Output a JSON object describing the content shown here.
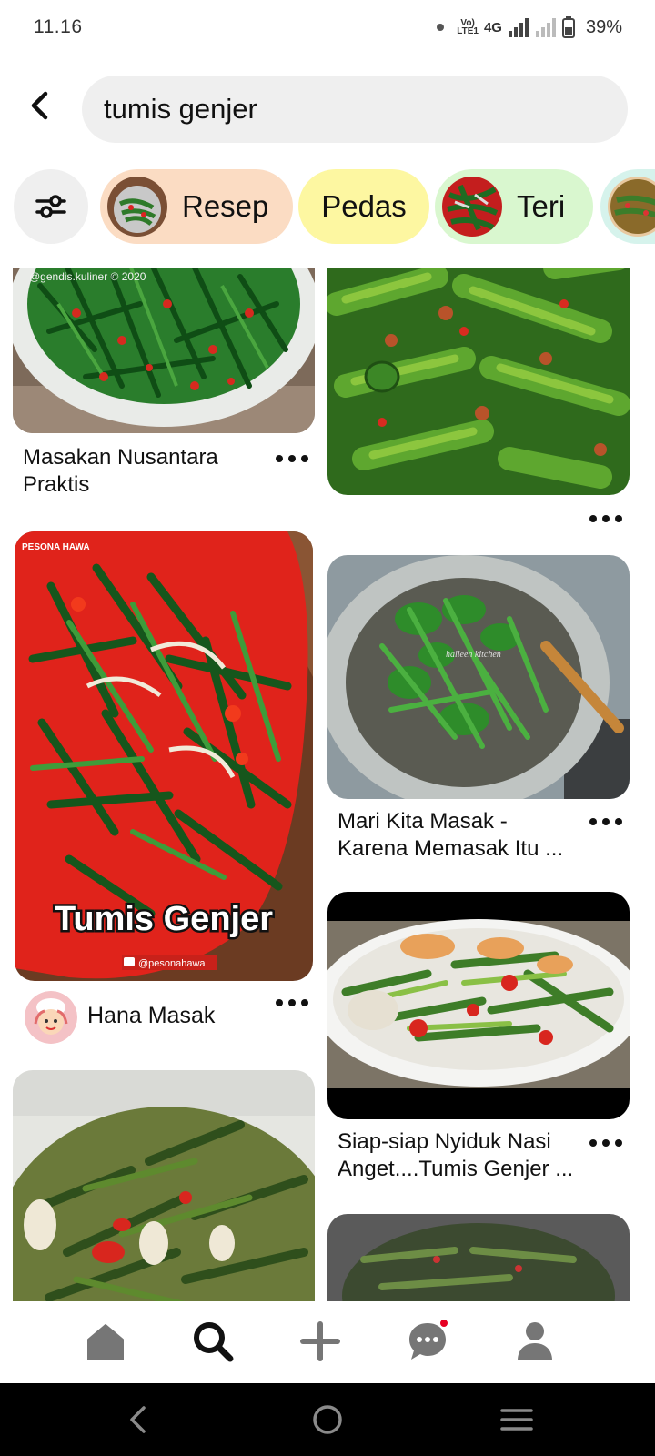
{
  "status_bar": {
    "time": "11.16",
    "volte": "Vo)\nLTE1",
    "network": "4G",
    "battery": "39%"
  },
  "search": {
    "query": "tumis genjer",
    "placeholder": ""
  },
  "chips": [
    {
      "label": "Resep",
      "color": "#fbdcc3"
    },
    {
      "label": "Pedas",
      "color": "#fdf7a1"
    },
    {
      "label": "Teri",
      "color": "#d9f7cf"
    },
    {
      "label": "",
      "color": "#d6f3ec"
    }
  ],
  "pins": {
    "left": [
      {
        "title": "Masakan Nusantara Praktis",
        "image_watermark": "@gendis.kuliner © 2020"
      },
      {
        "title": "",
        "image_text": "Tumis Genjer",
        "image_brand": "PESONA HAWA",
        "image_handle": "@pesonahawa",
        "creator": "Hana Masak"
      },
      {
        "title": ""
      }
    ],
    "right": [
      {
        "title": ""
      },
      {
        "title": "Mari Kita Masak - Karena Memasak Itu ...",
        "image_watermark": "halleen kitchen"
      },
      {
        "title": "Siap-siap Nyiduk Nasi Anget....Tumis Genjer ..."
      },
      {
        "title": ""
      }
    ]
  },
  "bottom_nav": {
    "items": [
      "home-icon",
      "search-icon",
      "create-icon",
      "messages-icon",
      "profile-icon"
    ],
    "active": "search-icon",
    "has_message_notification": true
  },
  "colors": {
    "accent_red": "#e60023",
    "chip_gray": "#efefef"
  }
}
